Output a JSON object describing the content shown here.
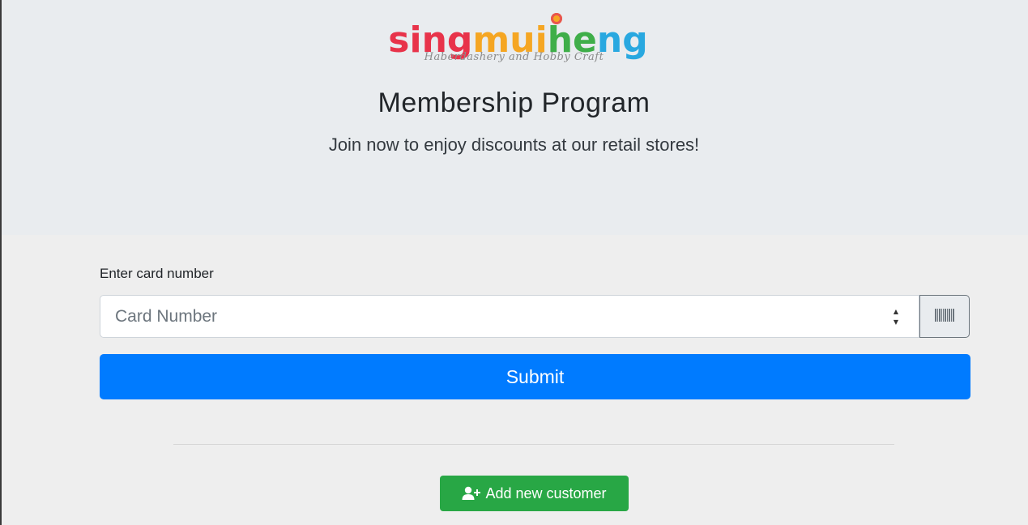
{
  "brand": {
    "letters": [
      {
        "ch": "s",
        "color": "#e8334a"
      },
      {
        "ch": "i",
        "color": "#e8334a"
      },
      {
        "ch": "n",
        "color": "#e8334a"
      },
      {
        "ch": "g",
        "color": "#e8334a"
      },
      {
        "ch": "m",
        "color": "#f5a623"
      },
      {
        "ch": "u",
        "color": "#f5a623"
      },
      {
        "ch": "i",
        "color": "#f5a623"
      },
      {
        "ch": "h",
        "color": "#3fae49"
      },
      {
        "ch": "e",
        "color": "#3fae49"
      },
      {
        "ch": "n",
        "color": "#29a8e0"
      },
      {
        "ch": "g",
        "color": "#29a8e0"
      }
    ],
    "tagline": "Haberdashery and Hobby Craft"
  },
  "hero": {
    "title": "Membership Program",
    "lead": "Join now to enjoy discounts at our retail stores!"
  },
  "form": {
    "label": "Enter card number",
    "card_placeholder": "Card Number",
    "card_value": "",
    "scan_icon": "barcode-icon",
    "submit_label": "Submit"
  },
  "actions": {
    "add_customer_label": "Add new customer",
    "add_customer_icon": "user-plus-icon"
  },
  "colors": {
    "primary": "#007bff",
    "success": "#28a745",
    "hero_bg": "#e9ecef",
    "page_bg": "#eeeeee"
  }
}
